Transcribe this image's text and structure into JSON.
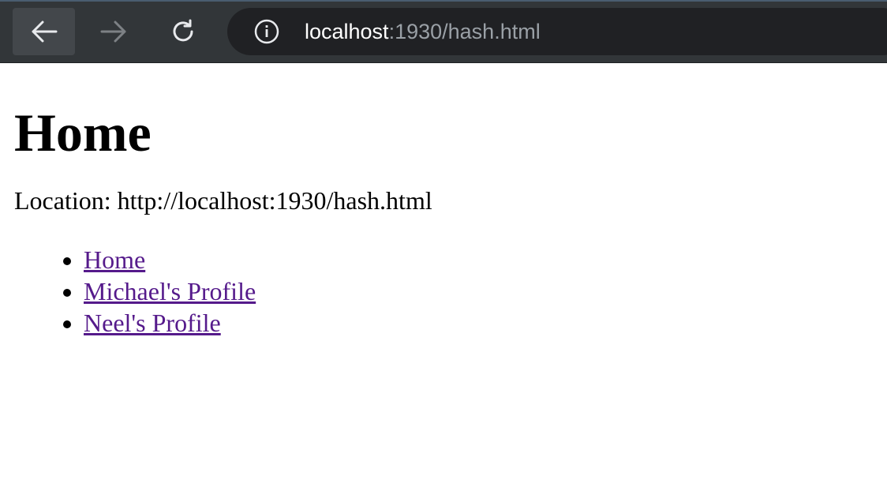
{
  "browser": {
    "back_icon": "arrow-left-icon",
    "forward_icon": "arrow-right-icon",
    "reload_icon": "reload-icon",
    "info_icon": "info-icon",
    "url_host": "localhost",
    "url_rest": ":1930/hash.html"
  },
  "page": {
    "heading": "Home",
    "location_text": "Location: http://localhost:1930/hash.html",
    "links": [
      {
        "label": "Home"
      },
      {
        "label": "Michael's Profile"
      },
      {
        "label": "Neel's Profile"
      }
    ]
  },
  "colors": {
    "toolbar": "#323639",
    "omnibox": "#202124",
    "visited_link": "#551a8b"
  }
}
